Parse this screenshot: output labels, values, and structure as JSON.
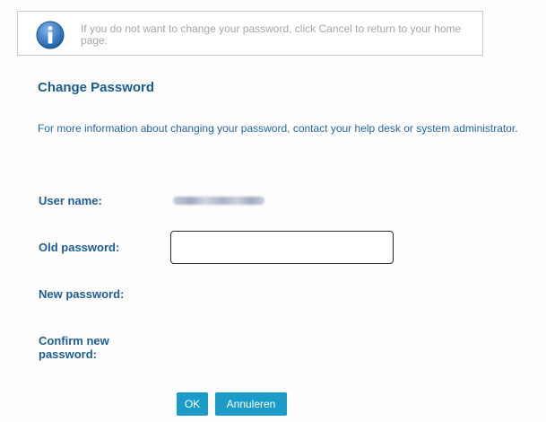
{
  "info_message": {
    "icon": "info-icon",
    "text": "If you do not want to change your password, click Cancel to return to your home page."
  },
  "form": {
    "title": "Change Password",
    "intro": "For more information about changing your password, contact your help desk or system administrator.",
    "user_name_label": "User name:",
    "old_password_label": "Old password:",
    "old_password_value": "",
    "new_password_label": "New password:",
    "confirm_password_label": "Confirm new password:"
  },
  "buttons": {
    "ok_label": "OK",
    "cancel_label": "Annuleren"
  },
  "colors": {
    "title": "#1a5c96",
    "label": "#1d5d97",
    "button": "#1a9bc8",
    "info_text": "#a6a6a6"
  }
}
